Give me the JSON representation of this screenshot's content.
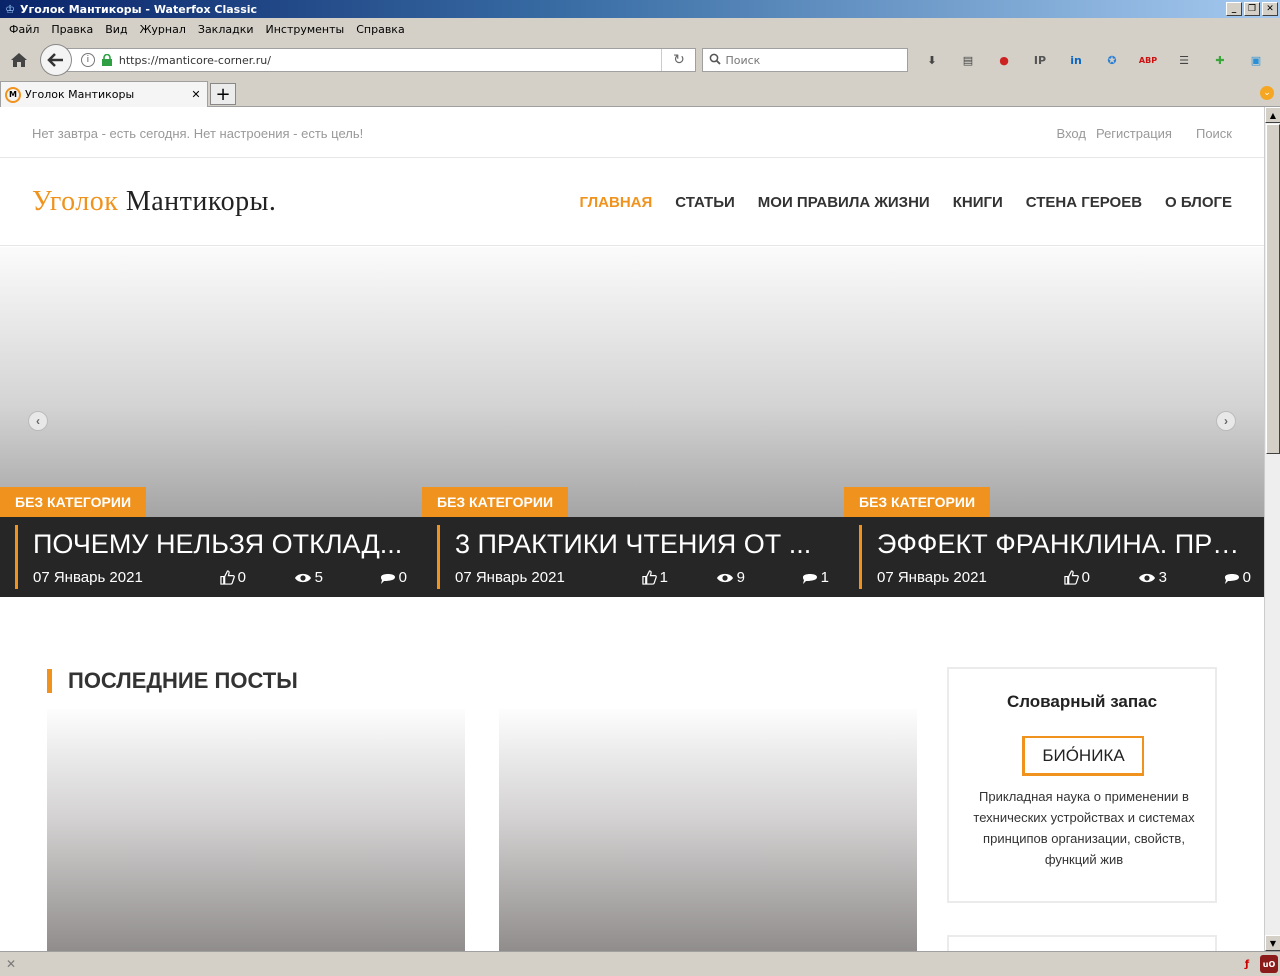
{
  "window": {
    "title": "Уголок Мантикоры - Waterfox Classic"
  },
  "menu": [
    "Файл",
    "Правка",
    "Вид",
    "Журнал",
    "Закладки",
    "Инструменты",
    "Справка"
  ],
  "nav": {
    "url": "https://manticore-corner.ru/",
    "search_placeholder": "Поиск"
  },
  "toolbar_icons": [
    {
      "name": "download-icon",
      "glyph": "⬇",
      "color": "#444444"
    },
    {
      "name": "library-icon",
      "glyph": "▤",
      "color": "#444444"
    },
    {
      "name": "addon-red-icon",
      "glyph": "●",
      "color": "#cc2222"
    },
    {
      "name": "ip-icon",
      "glyph": "IP",
      "color": "#555555"
    },
    {
      "name": "linkedin-icon",
      "glyph": "in",
      "color": "#0a66c2"
    },
    {
      "name": "translate-icon",
      "glyph": "✪",
      "color": "#2a7fd4"
    },
    {
      "name": "adblock-icon",
      "glyph": "ABP",
      "color": "#cc1111"
    },
    {
      "name": "menu-icon",
      "glyph": "☰",
      "color": "#444444"
    },
    {
      "name": "puzzle-icon",
      "glyph": "✚",
      "color": "#3aa53a"
    },
    {
      "name": "save-icon",
      "glyph": "▣",
      "color": "#2a8fd4"
    }
  ],
  "tab": {
    "label": "Уголок Мантикоры",
    "favicon_text": "M"
  },
  "page": {
    "slogan": "Нет завтра - есть сегодня. Нет настроения - есть цель!",
    "login": "Вход",
    "register": "Регистрация",
    "search": "Поиск",
    "logo_part1": "Уголок",
    "logo_part2": "Мантикоры.",
    "nav": [
      "ГЛАВНАЯ",
      "СТАТЬИ",
      "МОИ ПРАВИЛА ЖИЗНИ",
      "КНИГИ",
      "СТЕНА ГЕРОЕВ",
      "О БЛОГЕ"
    ],
    "slides": [
      {
        "category": "БЕЗ КАТЕГОРИИ",
        "title": "ПОЧЕМУ НЕЛЬЗЯ ОТКЛАД...",
        "date": "07 Январь 2021",
        "likes": "0",
        "views": "5",
        "comments": "0"
      },
      {
        "category": "БЕЗ КАТЕГОРИИ",
        "title": "3 ПРАКТИКИ ЧТЕНИЯ ОТ ...",
        "date": "07 Январь 2021",
        "likes": "1",
        "views": "9",
        "comments": "1"
      },
      {
        "category": "БЕЗ КАТЕГОРИИ",
        "title": "ЭФФЕКТ ФРАНКЛИНА. ПРЕ...",
        "date": "07 Январь 2021",
        "likes": "0",
        "views": "3",
        "comments": "0"
      }
    ],
    "latest_posts_title": "ПОСЛЕДНИЕ ПОСТЫ",
    "widget": {
      "title": "Словарный запас",
      "word": "БИО́НИКА",
      "definition": "Прикладная наука о применении в технических устройствах и системах принципов организации, свойств, функций жив"
    },
    "colors": {
      "accent": "#f0931e",
      "dark": "#262626"
    }
  }
}
